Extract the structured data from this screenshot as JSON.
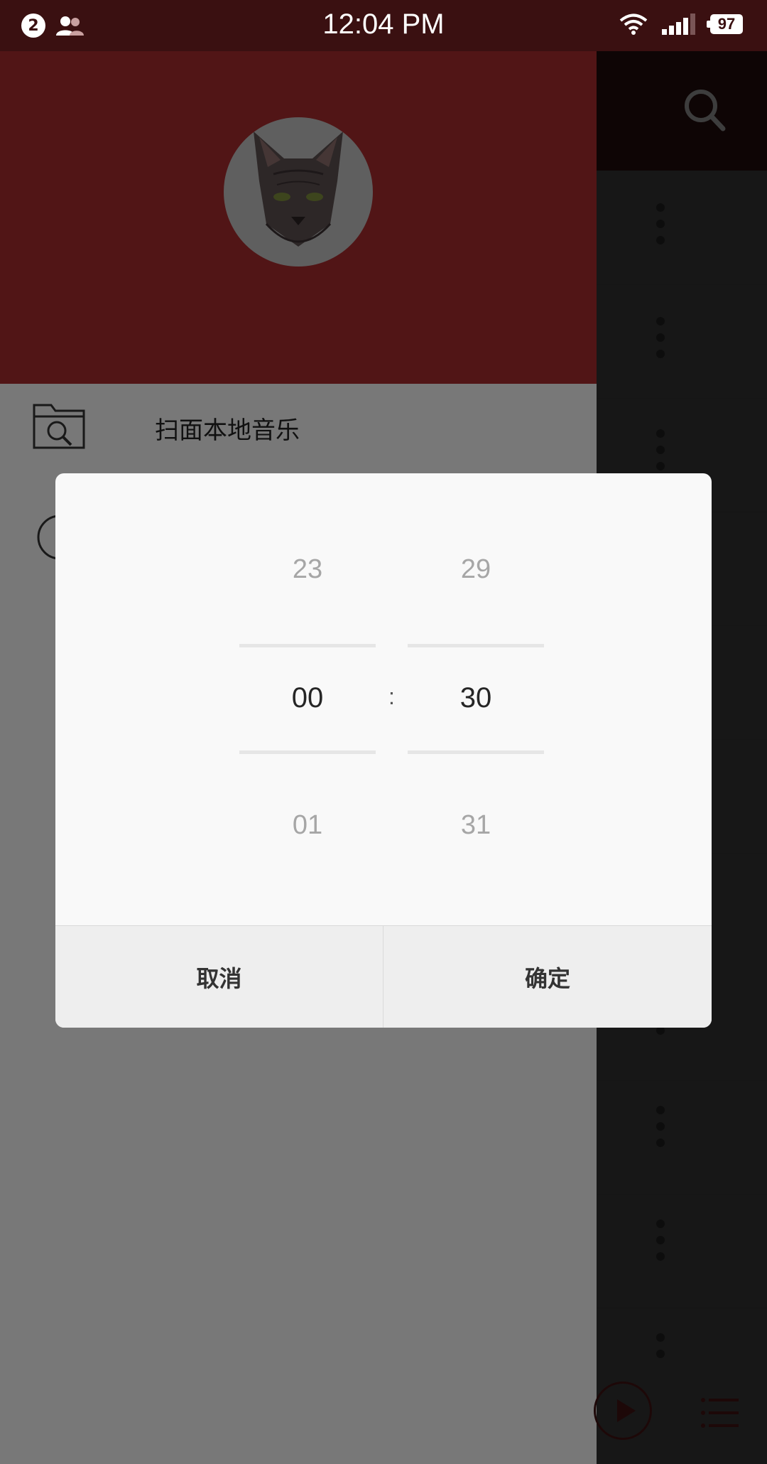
{
  "status_bar": {
    "notification_count": "2",
    "time": "12:04 PM",
    "battery": "97",
    "icons": [
      "contacts-icon",
      "wifi-icon",
      "signal-icon",
      "battery-icon"
    ]
  },
  "drawer": {
    "menu_items": [
      {
        "label": "扫面本地音乐",
        "icon": "folder-search-icon"
      },
      {
        "label": "",
        "icon": "timer-icon"
      }
    ]
  },
  "main": {
    "icons": [
      "search-icon",
      "more-vert-icon",
      "play-icon",
      "playlist-icon"
    ]
  },
  "time_picker": {
    "hours": {
      "prev": "23",
      "selected": "00",
      "next": "01"
    },
    "separator": ":",
    "minutes": {
      "prev": "29",
      "selected": "30",
      "next": "31"
    },
    "cancel_label": "取消",
    "confirm_label": "确定"
  },
  "colors": {
    "status_bar": "#3a1011",
    "drawer_header": "#a22b2d",
    "dialog_bg": "#f9f9f9"
  }
}
